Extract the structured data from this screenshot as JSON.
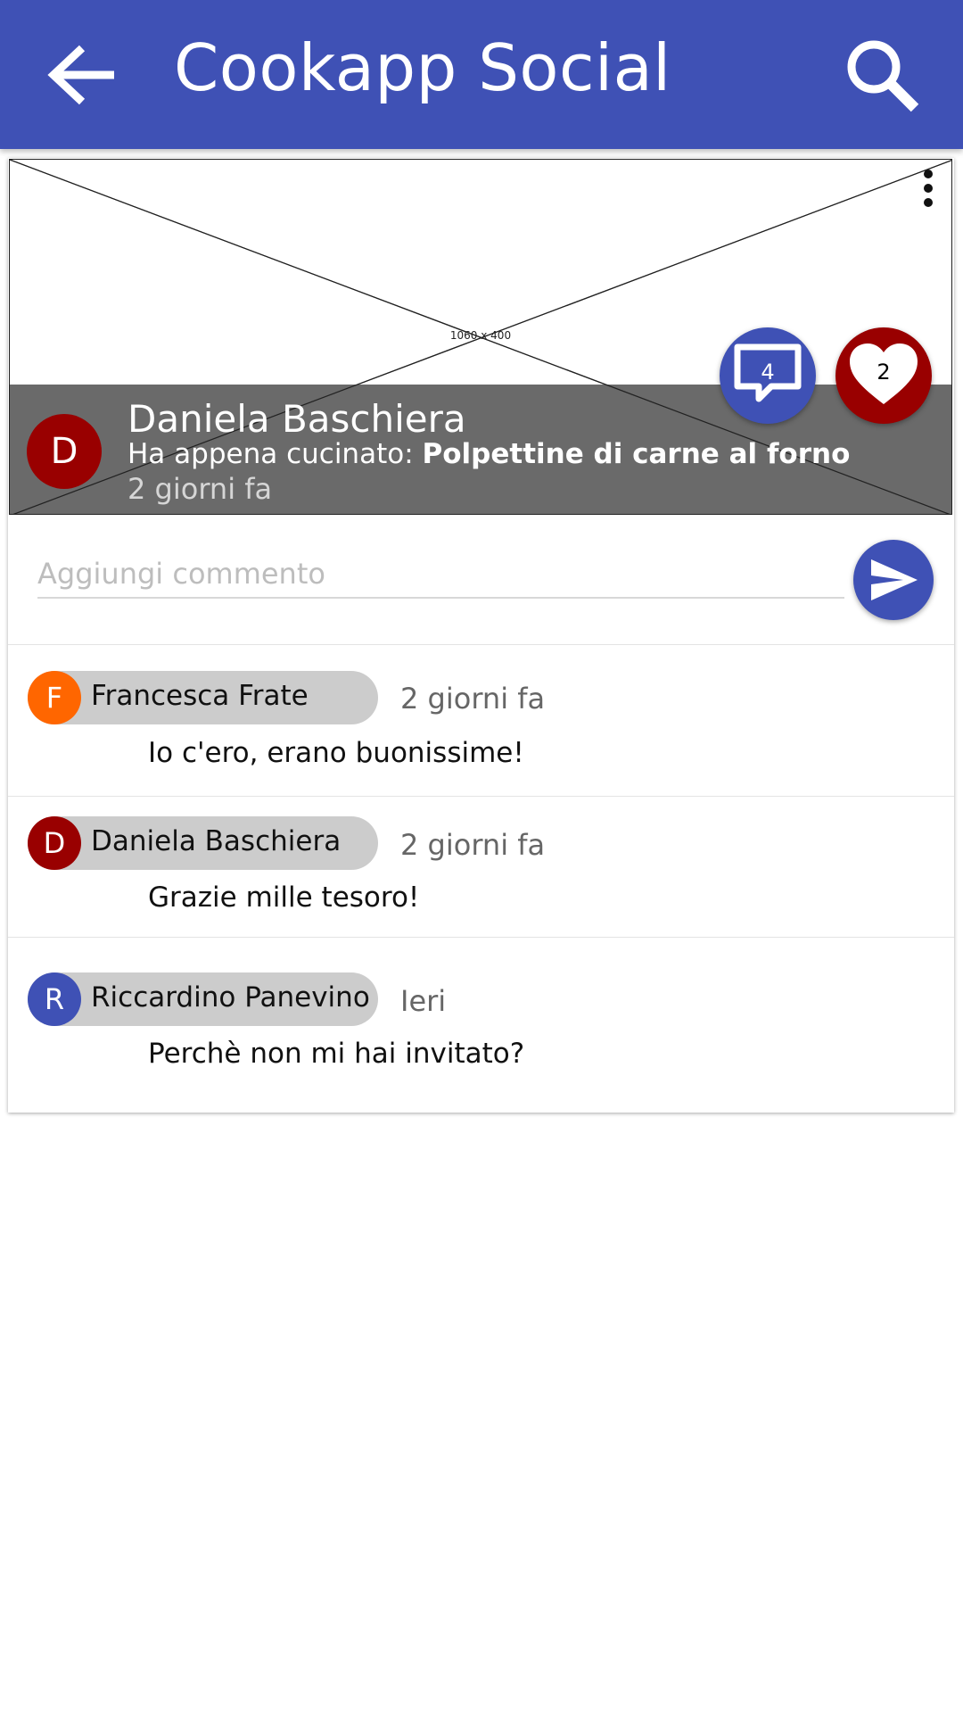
{
  "app": {
    "title": "Cookapp Social",
    "accent_color": "#3f51b5",
    "icons": {
      "back": "arrow-back-icon",
      "search": "search-icon"
    }
  },
  "post": {
    "image_placeholder_label": "1060 x 400",
    "author": {
      "initial": "D",
      "name": "Daniela Baschiera",
      "avatar_color": "#990000"
    },
    "cooked_prefix": "Ha appena cucinato:",
    "recipe": "Polpettine di carne al forno",
    "time": "2 giorni fa",
    "comments_count": "4",
    "likes_count": "2",
    "icons": {
      "menu": "more-vert-icon",
      "comments": "comment-icon",
      "likes": "heart-icon"
    }
  },
  "comment_box": {
    "placeholder": "Aggiungi commento",
    "value": "",
    "send_icon": "send-icon"
  },
  "comments": [
    {
      "initial": "F",
      "name": "Francesca Frate",
      "avatar_color": "#ff6600",
      "time": "2 giorni fa",
      "text": "Io c'ero, erano buonissime!"
    },
    {
      "initial": "D",
      "name": "Daniela Baschiera",
      "avatar_color": "#990000",
      "time": "2 giorni fa",
      "text": "Grazie mille tesoro!"
    },
    {
      "initial": "R",
      "name": "Riccardino Panevino",
      "avatar_color": "#3f51b5",
      "time": "Ieri",
      "text": "Perchè non mi hai invitato?"
    }
  ]
}
